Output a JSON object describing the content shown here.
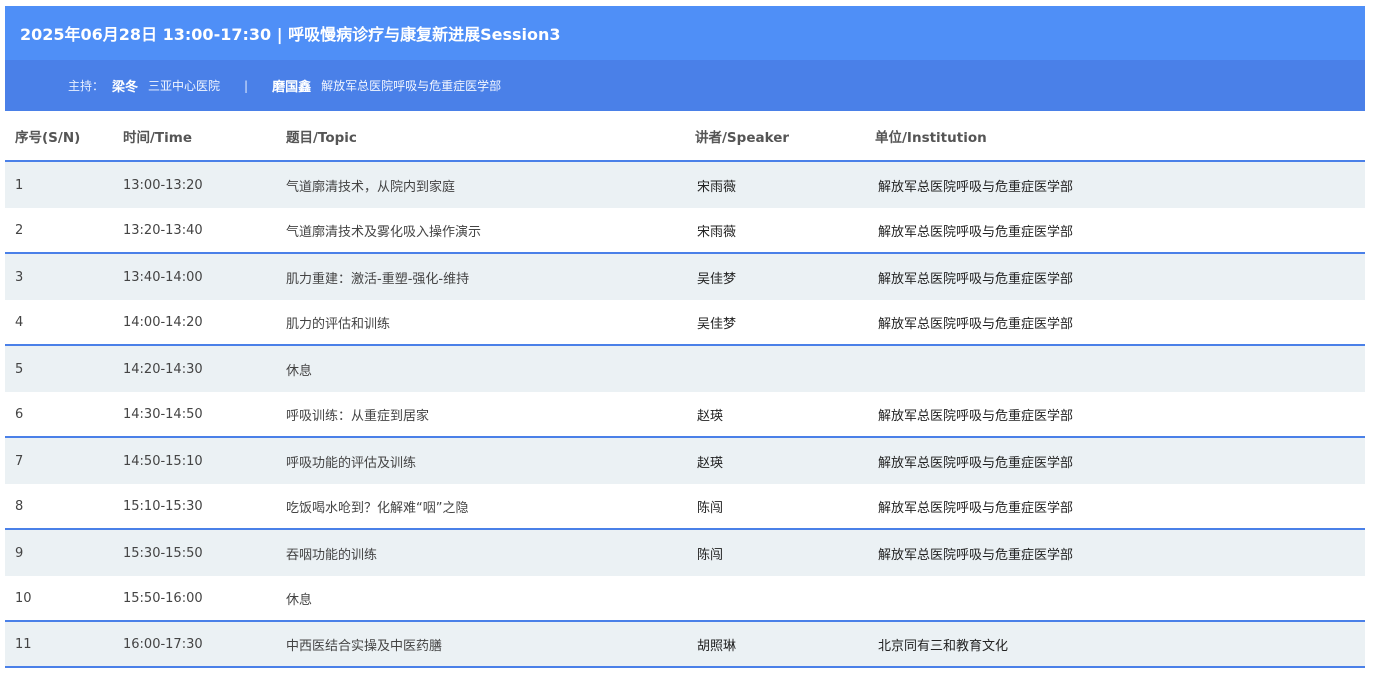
{
  "session": {
    "title": "2025年06月28日 13:00-17:30 | 呼吸慢病诊疗与康复新进展Session3",
    "host_label": "主持：",
    "hosts": [
      {
        "name": "梁冬",
        "institution": "三亚中心医院"
      },
      {
        "name": "磨国鑫",
        "institution": "解放军总医院呼吸与危重症医学部"
      }
    ],
    "separator": "|"
  },
  "table": {
    "headers": [
      "序号(S/N)",
      "时间/Time",
      "题目/Topic",
      "讲者/Speaker",
      "单位/Institution"
    ],
    "rows": [
      [
        "1",
        "13:00-13:20",
        "气道廓清技术，从院内到家庭",
        "宋雨薇",
        "解放军总医院呼吸与危重症医学部"
      ],
      [
        "2",
        "13:20-13:40",
        "气道廓清技术及雾化吸入操作演示",
        "宋雨薇",
        "解放军总医院呼吸与危重症医学部"
      ],
      [
        "3",
        "13:40-14:00",
        "肌力重建：激活-重塑-强化-维持",
        "吴佳梦",
        "解放军总医院呼吸与危重症医学部"
      ],
      [
        "4",
        "14:00-14:20",
        "肌力的评估和训练",
        "吴佳梦",
        "解放军总医院呼吸与危重症医学部"
      ],
      [
        "5",
        "14:20-14:30",
        "休息",
        "",
        ""
      ],
      [
        "6",
        "14:30-14:50",
        "呼吸训练：从重症到居家",
        "赵瑛",
        "解放军总医院呼吸与危重症医学部"
      ],
      [
        "7",
        "14:50-15:10",
        "呼吸功能的评估及训练",
        "赵瑛",
        "解放军总医院呼吸与危重症医学部"
      ],
      [
        "8",
        "15:10-15:30",
        "吃饭喝水呛到？化解难“咽”之隐",
        "陈闯",
        "解放军总医院呼吸与危重症医学部"
      ],
      [
        "9",
        "15:30-15:50",
        "吞咽功能的训练",
        "陈闯",
        "解放军总医院呼吸与危重症医学部"
      ],
      [
        "10",
        "15:50-16:00",
        "休息",
        "",
        ""
      ],
      [
        "11",
        "16:00-17:30",
        "中西医结合实操及中医药膳",
        "胡照琳",
        "北京同有三和教育文化"
      ]
    ]
  },
  "colors": {
    "title_bg": "#4f8ff7",
    "host_bg": "#4a80e8",
    "row_shade": "#ebf1f4",
    "divider": "#4a80e8"
  }
}
